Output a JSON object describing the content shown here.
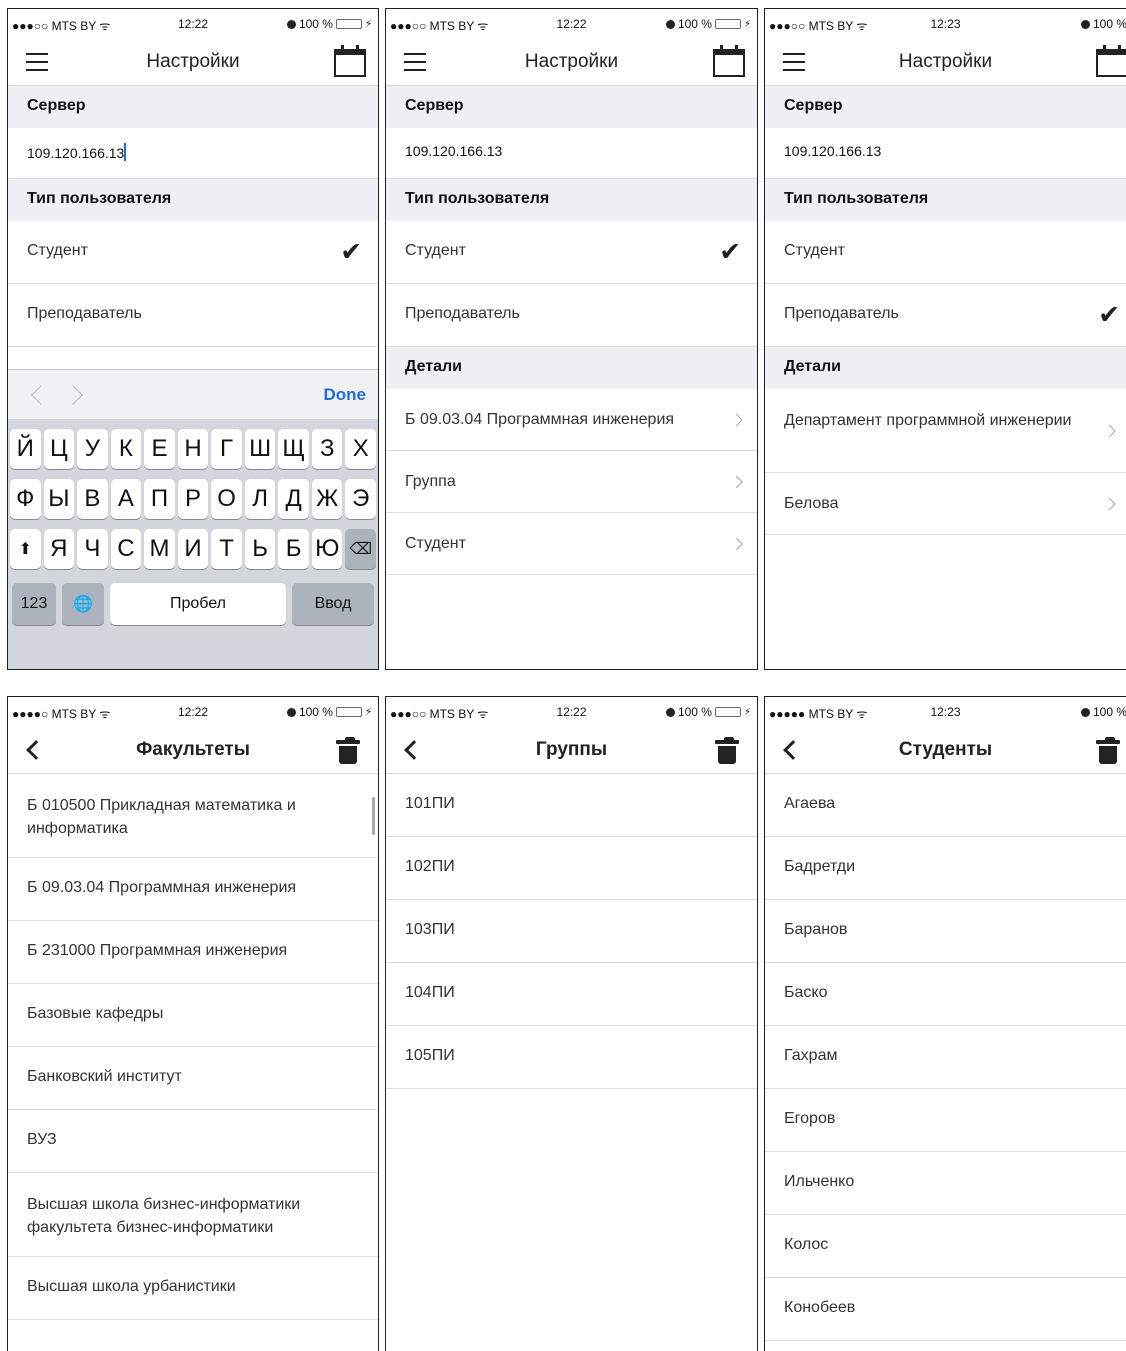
{
  "status": {
    "carrier": "●●●○○ MTS BY ᯤ",
    "carrier_full": "●●●●○ MTS BY ᯤ",
    "carrier_full5": "●●●●● MTS BY ᯤ",
    "time_1222": "12:22",
    "time_1223": "12:23",
    "battery": "100 %",
    "bolt": "⚡"
  },
  "settings": {
    "title": "Настройки",
    "server_header": "Сервер",
    "server_value": "109.120.166.13",
    "user_type_header": "Тип пользователя",
    "student": "Студент",
    "teacher": "Преподаватель",
    "details_header": "Детали",
    "checkmark": "✔"
  },
  "screen2": {
    "details": [
      "Б 09.03.04 Программная инженерия",
      "Группа",
      "Студент"
    ]
  },
  "screen3": {
    "details": [
      "Департамент программной инженерии",
      "Белова"
    ]
  },
  "keyboard": {
    "done": "Done",
    "row1": [
      "Й",
      "Ц",
      "У",
      "К",
      "Е",
      "Н",
      "Г",
      "Ш",
      "Щ",
      "З",
      "Х"
    ],
    "row2": [
      "Ф",
      "Ы",
      "В",
      "А",
      "П",
      "Р",
      "О",
      "Л",
      "Д",
      "Ж",
      "Э"
    ],
    "row3": [
      "Я",
      "Ч",
      "С",
      "М",
      "И",
      "Т",
      "Ь",
      "Б",
      "Ю"
    ],
    "shift": "⬆",
    "backspace": "⌫",
    "numbers": "123",
    "globe": "🌐",
    "space": "Пробел",
    "enter": "Ввод"
  },
  "faculties": {
    "title": "Факультеты",
    "items": [
      "Б 010500 Прикладная математика и информатика",
      "Б 09.03.04 Программная инженерия",
      "Б 231000 Программная инженерия",
      "Базовые кафедры",
      "Банковский институт",
      "ВУЗ",
      "Высшая школа бизнес-информатики факультета бизнес-информатики",
      "Высшая школа урбанистики"
    ]
  },
  "groups": {
    "title": "Группы",
    "items": [
      "101ПИ",
      "102ПИ",
      "103ПИ",
      "104ПИ",
      "105ПИ"
    ]
  },
  "students": {
    "title": "Студенты",
    "items": [
      "Агаева",
      "Бадретди",
      "Баранов",
      "Баско",
      "Гахрам",
      "Егоров",
      "Ильченко",
      "Колос",
      "Конобеев"
    ]
  }
}
